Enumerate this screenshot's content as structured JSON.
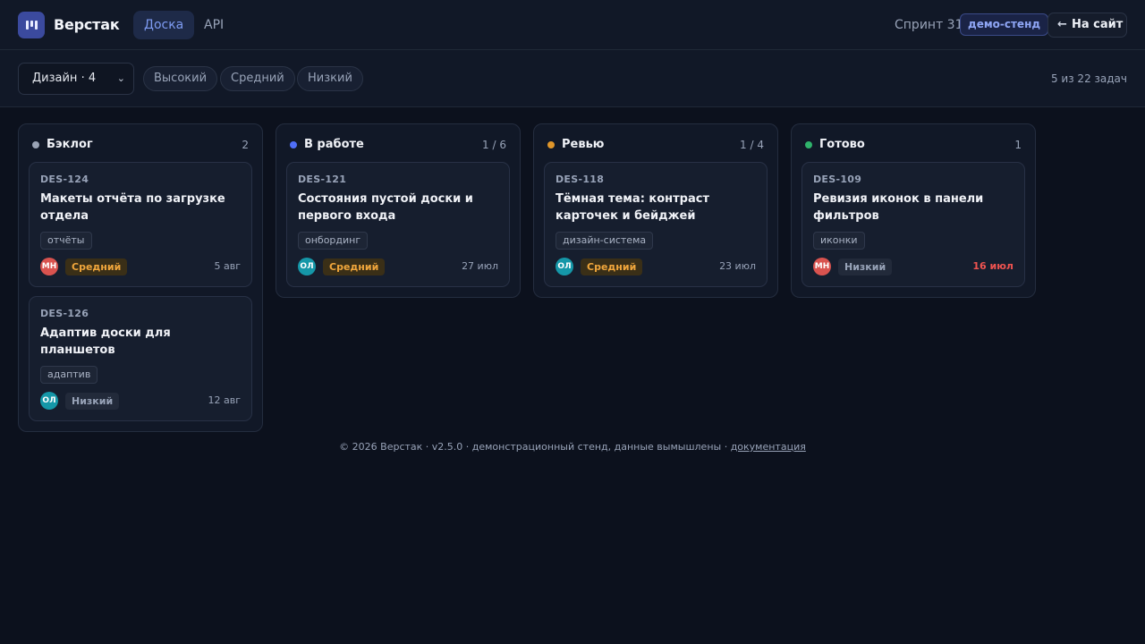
{
  "header": {
    "brand": "Верстак",
    "tabs": [
      {
        "label": "Доска",
        "active": true
      },
      {
        "label": "API",
        "active": false
      }
    ],
    "sprint": "Спринт 31",
    "env_badge": "демо-стенд",
    "back_label": "На сайт",
    "back_icon": "arrow-left-icon",
    "logo_icon": "board-logo-icon"
  },
  "filters": {
    "select_value": "Дизайн · 4",
    "chips": [
      "Высокий",
      "Средний",
      "Низкий"
    ],
    "counter": "5 из 22 задач"
  },
  "columns": [
    {
      "title": "Бэклог",
      "count": "2",
      "dot_color": "#9aa3b5",
      "cards": [
        {
          "id": "DES-124",
          "title": "Макеты отчёта по загрузке отдела",
          "tag": "отчёты",
          "avatar": "МН",
          "avatar_color": "#d9534f",
          "priority": "Средний",
          "priority_level": "mid",
          "due": "5 авг",
          "overdue": false
        },
        {
          "id": "DES-126",
          "title": "Адаптив доски для планшетов",
          "tag": "адаптив",
          "avatar": "ОЛ",
          "avatar_color": "#1597a8",
          "priority": "Низкий",
          "priority_level": "low",
          "due": "12 авг",
          "overdue": false
        }
      ]
    },
    {
      "title": "В работе",
      "count": "1 / 6",
      "dot_color": "#4f6ef7",
      "cards": [
        {
          "id": "DES-121",
          "title": "Состояния пустой доски и первого входа",
          "tag": "онбординг",
          "avatar": "ОЛ",
          "avatar_color": "#1597a8",
          "priority": "Средний",
          "priority_level": "mid",
          "due": "27 июл",
          "overdue": false
        }
      ]
    },
    {
      "title": "Ревью",
      "count": "1 / 4",
      "dot_color": "#e0962a",
      "cards": [
        {
          "id": "DES-118",
          "title": "Тёмная тема: контраст карточек и бейджей",
          "tag": "дизайн-система",
          "avatar": "ОЛ",
          "avatar_color": "#1597a8",
          "priority": "Средний",
          "priority_level": "mid",
          "due": "23 июл",
          "overdue": false
        }
      ]
    },
    {
      "title": "Готово",
      "count": "1",
      "dot_color": "#2fb36b",
      "cards": [
        {
          "id": "DES-109",
          "title": "Ревизия иконок в панели фильтров",
          "tag": "иконки",
          "avatar": "МН",
          "avatar_color": "#d9534f",
          "priority": "Низкий",
          "priority_level": "low",
          "due": "16 июл",
          "overdue": true
        }
      ]
    }
  ],
  "footer": {
    "text": "© 2026 Верстак · v2.5.0 · демонстрационный стенд, данные вымышлены · ",
    "link": "документация"
  }
}
